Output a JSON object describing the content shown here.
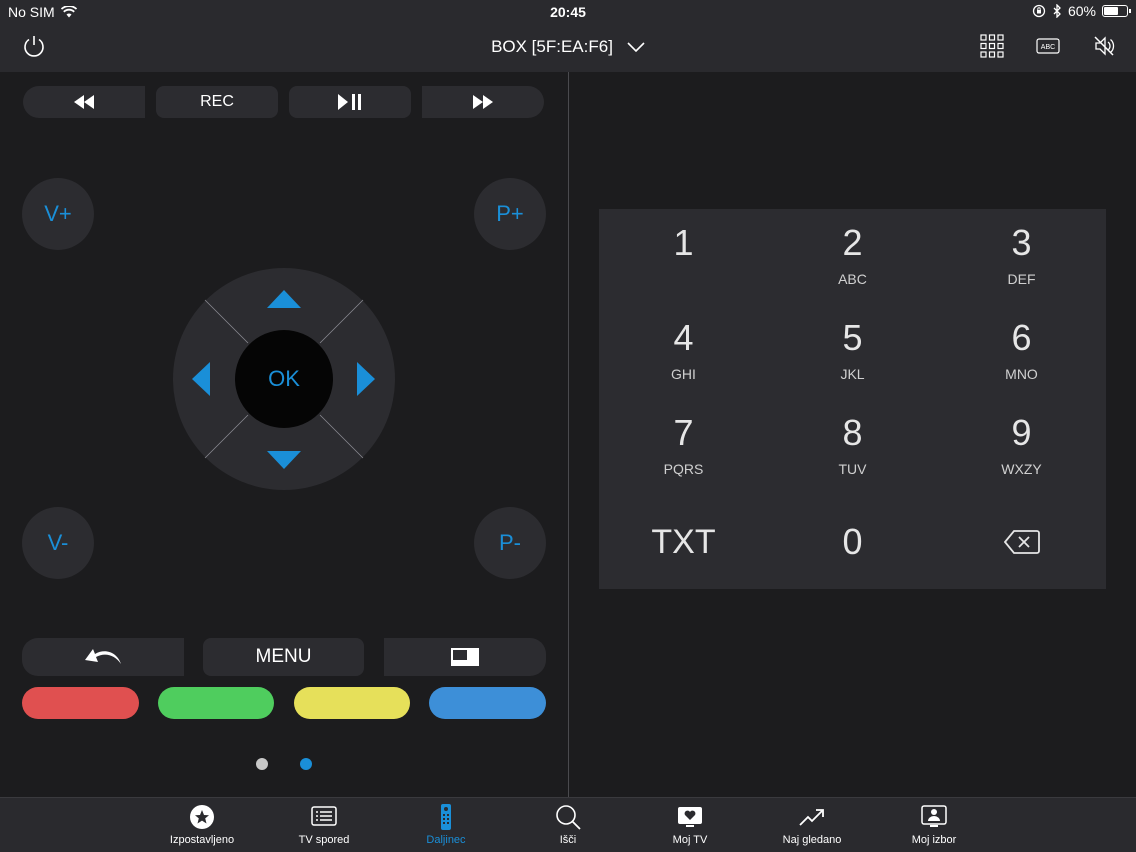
{
  "status": {
    "carrier": "No SIM",
    "time": "20:45",
    "battery": "60%"
  },
  "topbar": {
    "device_name": "BOX [5F:EA:F6]",
    "abc_label": "ABC"
  },
  "transport": {
    "rec_label": "REC"
  },
  "volume": {
    "up": "V+",
    "down": "V-"
  },
  "program": {
    "up": "P+",
    "down": "P-"
  },
  "dpad": {
    "ok": "OK"
  },
  "bottom_controls": {
    "menu_label": "MENU"
  },
  "keypad": {
    "keys": [
      {
        "num": "1",
        "sub": ""
      },
      {
        "num": "2",
        "sub": "ABC"
      },
      {
        "num": "3",
        "sub": "DEF"
      },
      {
        "num": "4",
        "sub": "GHI"
      },
      {
        "num": "5",
        "sub": "JKL"
      },
      {
        "num": "6",
        "sub": "MNO"
      },
      {
        "num": "7",
        "sub": "PQRS"
      },
      {
        "num": "8",
        "sub": "TUV"
      },
      {
        "num": "9",
        "sub": "WXZY"
      },
      {
        "num": "TXT",
        "sub": ""
      },
      {
        "num": "0",
        "sub": ""
      }
    ]
  },
  "colors": {
    "accent": "#1a8fd8",
    "red": "#e05050",
    "green": "#4fcd5e",
    "yellow": "#e6e05a",
    "blue": "#3d8fd8"
  },
  "pager": {
    "pages": 2,
    "active": 2
  },
  "nav": {
    "items": [
      {
        "label": "Izpostavljeno",
        "icon": "star-icon"
      },
      {
        "label": "TV spored",
        "icon": "tv-guide-icon"
      },
      {
        "label": "Daljinec",
        "icon": "remote-icon",
        "active": true
      },
      {
        "label": "Išči",
        "icon": "search-icon"
      },
      {
        "label": "Moj TV",
        "icon": "heart-tv-icon"
      },
      {
        "label": "Naj gledano",
        "icon": "trending-icon"
      },
      {
        "label": "Moj izbor",
        "icon": "person-icon"
      }
    ]
  }
}
